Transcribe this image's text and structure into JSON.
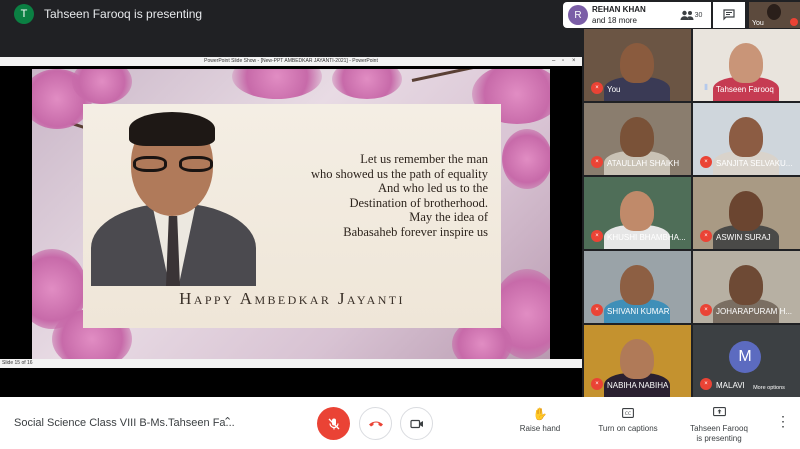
{
  "top": {
    "presenter_initial": "T",
    "presenter_title": "Tahseen Farooq is presenting",
    "people_initial": "R",
    "people_name": "REHAN KHAN",
    "people_more": "and 18 more",
    "participants_count": "30",
    "self_label": "You"
  },
  "presentation": {
    "window_title": "PowerPoint Slide Show - [New-PPT AMBEDKAR JAYANTI-2021] - PowerPoint",
    "status_text": "Slide 15 of 16",
    "slide_text": "Let us remember the man\nwho showed us the path of equality\nAnd who led us to the\nDestination of brotherhood.\nMay the idea of\nBabasaheb forever inspire us",
    "slide_banner": "Happy Ambedkar Jayanti"
  },
  "participants": [
    {
      "name": "You",
      "mic": "muted",
      "bg": "#6b5544",
      "skin": "#8a5b3e",
      "cloth": "#3a3a55"
    },
    {
      "name": "Tahseen Farooq",
      "mic": "speaking",
      "bg": "#e9e4dd",
      "skin": "#c99578",
      "cloth": "#c63b52"
    },
    {
      "name": "ATAULLAH SHAIKH",
      "mic": "muted",
      "bg": "#8a7d6e",
      "skin": "#7a5238",
      "cloth": "#c9c2b5"
    },
    {
      "name": "SANJITA SELVAKU...",
      "mic": "muted",
      "bg": "#cfd6dc",
      "skin": "#8c5c43",
      "cloth": "#d9d3cb"
    },
    {
      "name": "KHUSHI BHAMBHA...",
      "mic": "muted",
      "bg": "#4f6e58",
      "skin": "#c08a6a",
      "cloth": "#e6e6e6"
    },
    {
      "name": "ASWIN SURAJ",
      "mic": "muted",
      "bg": "#a99a84",
      "skin": "#6b4530",
      "cloth": "#4a4a48"
    },
    {
      "name": "SHIVANI KUMAR",
      "mic": "muted",
      "bg": "#9aa3a8",
      "skin": "#8d5f43",
      "cloth": "#3f8fb8"
    },
    {
      "name": "JOHARAPURAM H...",
      "mic": "muted",
      "bg": "#b7b0a3",
      "skin": "#6e4a35",
      "cloth": "#7a6e62"
    },
    {
      "name": "NABIHA NABIHA",
      "mic": "muted",
      "bg": "#c4922f",
      "skin": "#b07a58",
      "cloth": "#2a2030"
    },
    {
      "name": "MALAVI",
      "mic": "muted",
      "avatar": "M"
    }
  ],
  "tooltip": "More options",
  "bottom": {
    "meeting_title": "Social Science Class VIII B-Ms.Tahseen Fa...",
    "raise_hand": "Raise hand",
    "captions": "Turn on captions",
    "presenting": "Tahseen Farooq\nis presenting"
  }
}
